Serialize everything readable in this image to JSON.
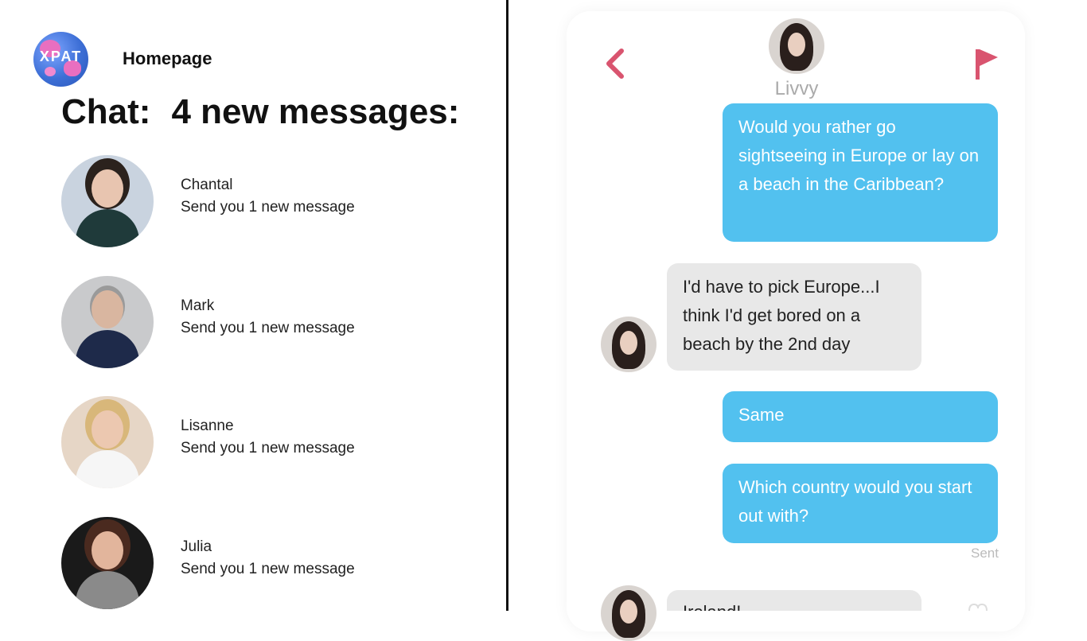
{
  "logo": {
    "text": "XPAT",
    "icon": "globe-logo"
  },
  "nav": {
    "homepage": "Homepage"
  },
  "header": {
    "chat_label": "Chat:",
    "new_messages": "4 new messages:"
  },
  "contacts": [
    {
      "name": "Chantal",
      "message": "Send you 1 new message"
    },
    {
      "name": "Mark",
      "message": "Send you 1 new message"
    },
    {
      "name": "Lisanne",
      "message": "Send you 1 new message"
    },
    {
      "name": "Julia",
      "message": "Send you 1 new message"
    }
  ],
  "chat": {
    "peer_name": "Livvy",
    "back_icon": "chevron-left-icon",
    "report_icon": "flag-icon",
    "accent_color": "#d9546f",
    "outgoing_color": "#52c1ef",
    "incoming_color": "#e8e8e8",
    "messages": [
      {
        "direction": "out",
        "text": "Would you rather go sightseeing in Europe or lay on a beach in the Caribbean?"
      },
      {
        "direction": "in",
        "text": "I'd have to pick Europe...I think I'd get bored on a beach by the 2nd day"
      },
      {
        "direction": "out",
        "text": "Same"
      },
      {
        "direction": "out",
        "text": "Which country would you start out with?"
      },
      {
        "direction": "in",
        "text": "Ireland!"
      }
    ],
    "status": "Sent"
  }
}
